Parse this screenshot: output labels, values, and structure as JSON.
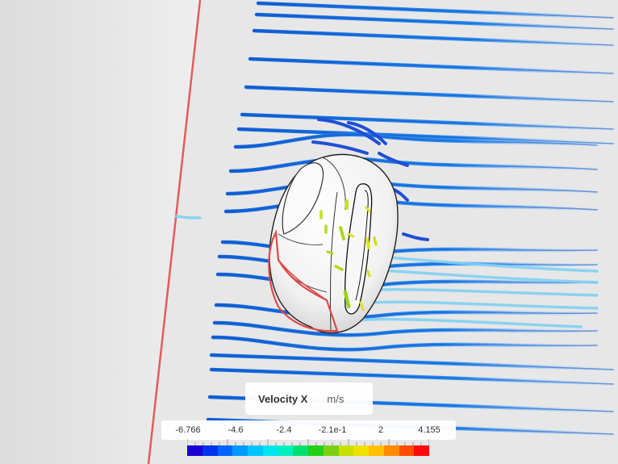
{
  "legend": {
    "field": "Velocity X",
    "unit": "m/s",
    "ticks": [
      "-6.766",
      "-4.6",
      "-2.4",
      "-2.1e-1",
      "2",
      "4.155"
    ],
    "colors": [
      "#1a00d6",
      "#0033f0",
      "#0066ff",
      "#0099ff",
      "#00c4ff",
      "#00e5f0",
      "#00f0c0",
      "#00e070",
      "#22d01a",
      "#7ad010",
      "#c8e000",
      "#f0e000",
      "#ffc000",
      "#ff8a00",
      "#ff4d00",
      "#ff0a0a"
    ]
  }
}
